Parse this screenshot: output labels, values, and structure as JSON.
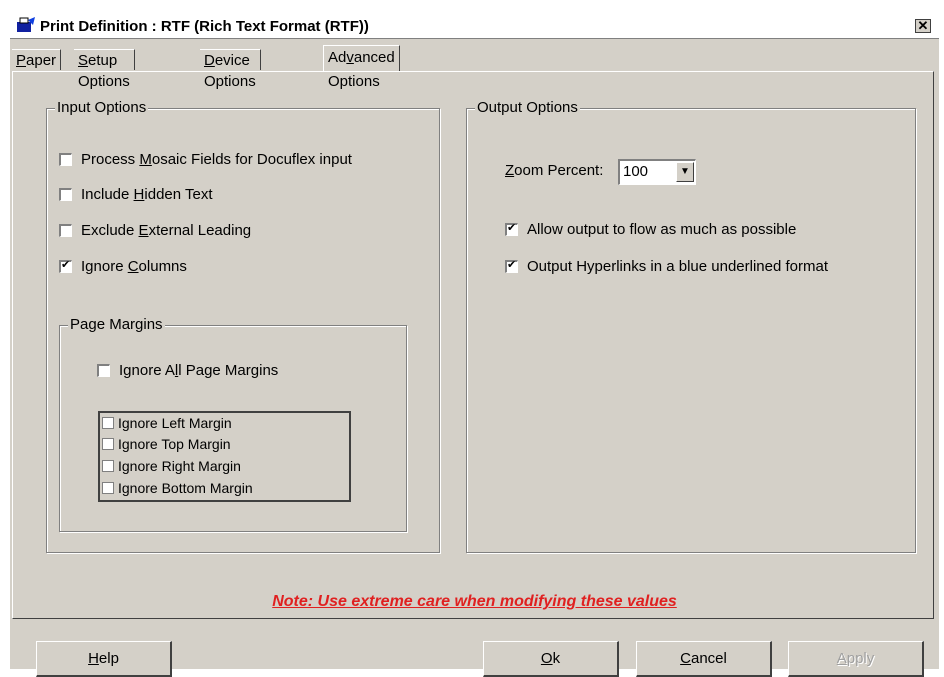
{
  "window": {
    "title": "Print Definition : RTF (Rich Text Format (RTF))",
    "close_label": "✕"
  },
  "tabs": [
    {
      "label_pre": "",
      "label_key": "P",
      "label_post": "aper"
    },
    {
      "label_pre": "",
      "label_key": "S",
      "label_post": "etup Options"
    },
    {
      "label_pre": "",
      "label_key": "D",
      "label_post": "evice Options"
    },
    {
      "label_pre": "Ad",
      "label_key": "v",
      "label_post": "anced Options"
    }
  ],
  "input_options": {
    "label": "Input Options",
    "items": [
      {
        "pre": "Process ",
        "key": "M",
        "post": "osaic Fields for Docuflex input",
        "checked": false
      },
      {
        "pre": "Include ",
        "key": "H",
        "post": "idden Text",
        "checked": false
      },
      {
        "pre": "Exclude ",
        "key": "E",
        "post": "xternal Leading",
        "checked": false
      },
      {
        "pre": "Ignore ",
        "key": "C",
        "post": "olumns",
        "checked": true
      }
    ],
    "page_margins": {
      "label": "Page Margins",
      "all": {
        "pre": "Ignore A",
        "key": "l",
        "post": "l Page Margins",
        "checked": false
      },
      "margins": [
        {
          "label": "Ignore Left Margin",
          "checked": false
        },
        {
          "label": "Ignore Top Margin",
          "checked": false
        },
        {
          "label": "Ignore Right Margin",
          "checked": false
        },
        {
          "label": "Ignore Bottom Margin",
          "checked": false
        }
      ]
    }
  },
  "output_options": {
    "label": "Output Options",
    "zoom": {
      "pre": "",
      "key": "Z",
      "post": "oom Percent:",
      "value": "100"
    },
    "items": [
      {
        "label": "Allow output to flow as much as possible",
        "checked": true
      },
      {
        "label": "Output Hyperlinks in a blue underlined format",
        "checked": true
      }
    ]
  },
  "note": "Note: Use extreme care when modifying these values",
  "buttons": {
    "help": {
      "key": "H",
      "post": "elp"
    },
    "ok": {
      "key": "O",
      "post": "k"
    },
    "cancel": {
      "key": "C",
      "post": "ancel"
    },
    "apply": {
      "key": "A",
      "post": "pply"
    }
  },
  "colors": {
    "note": "#e02020",
    "face": "#d4d0c8"
  }
}
